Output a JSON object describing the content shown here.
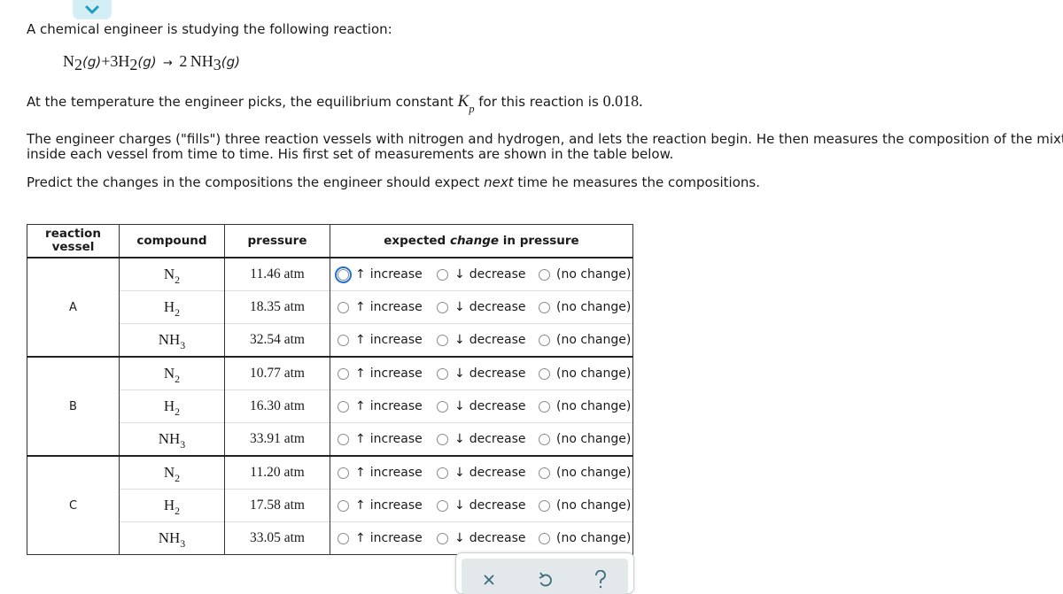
{
  "intro": "A chemical engineer is studying the following reaction:",
  "equation": {
    "reactant1": {
      "symbol": "N",
      "sub": "2",
      "state": "(g)"
    },
    "plus": "+",
    "reactant2": {
      "coef": "3",
      "symbol": "H",
      "sub": "2",
      "state": "(g)"
    },
    "arrow": "→",
    "product": {
      "coef": "2",
      "symbol": "NH",
      "sub": "3",
      "state": "(g)"
    }
  },
  "kp_text": {
    "before": "At the temperature the engineer picks, the equilibrium constant ",
    "k": "K",
    "k_sub": "p",
    "middle": " for this reaction is ",
    "value": "0.018",
    "after": "."
  },
  "description": {
    "line1": "The engineer charges (\"fills\") three reaction vessels with nitrogen and hydrogen, and lets the reaction begin. He then measures the composition of the mixture",
    "line2": "inside each vessel from time to time. His first set of measurements are shown in the table below."
  },
  "prompt": {
    "before": "Predict the changes in the compositions the engineer should expect ",
    "emphasis": "next",
    "after": " time he measures the compositions."
  },
  "table": {
    "headers": {
      "vessel": "reaction vessel",
      "compound": "compound",
      "pressure": "pressure",
      "change_before": "expected ",
      "change_emphasis": "change",
      "change_after": " in pressure"
    },
    "option_labels": {
      "increase_arrow": "↑",
      "increase": "increase",
      "decrease_arrow": "↓",
      "decrease": "decrease",
      "no_change": "(no change)"
    },
    "vessels": [
      {
        "name": "A",
        "rows": [
          {
            "symbol": "N",
            "sub": "2",
            "pressure": "11.46 atm",
            "selected": null
          },
          {
            "symbol": "H",
            "sub": "2",
            "pressure": "18.35 atm",
            "selected": null
          },
          {
            "symbol": "NH",
            "sub": "3",
            "pressure": "32.54 atm",
            "selected": null
          }
        ]
      },
      {
        "name": "B",
        "rows": [
          {
            "symbol": "N",
            "sub": "2",
            "pressure": "10.77 atm",
            "selected": null
          },
          {
            "symbol": "H",
            "sub": "2",
            "pressure": "16.30 atm",
            "selected": null
          },
          {
            "symbol": "NH",
            "sub": "3",
            "pressure": "33.91 atm",
            "selected": null
          }
        ]
      },
      {
        "name": "C",
        "rows": [
          {
            "symbol": "N",
            "sub": "2",
            "pressure": "11.20 atm",
            "selected": null
          },
          {
            "symbol": "H",
            "sub": "2",
            "pressure": "17.58 atm",
            "selected": null
          },
          {
            "symbol": "NH",
            "sub": "3",
            "pressure": "33.05 atm",
            "selected": null
          }
        ]
      }
    ],
    "focused_radio": "A-N2-increase"
  },
  "actions": {
    "icons": [
      "close-icon",
      "undo-icon",
      "help-icon"
    ],
    "colors": {
      "icon": "#3b6c7c",
      "panel": "#e3e8ea",
      "collapse_bg": "#d4eef5",
      "collapse_chevron": "#1e9bc1",
      "focus_ring": "#1f6fd6"
    }
  }
}
